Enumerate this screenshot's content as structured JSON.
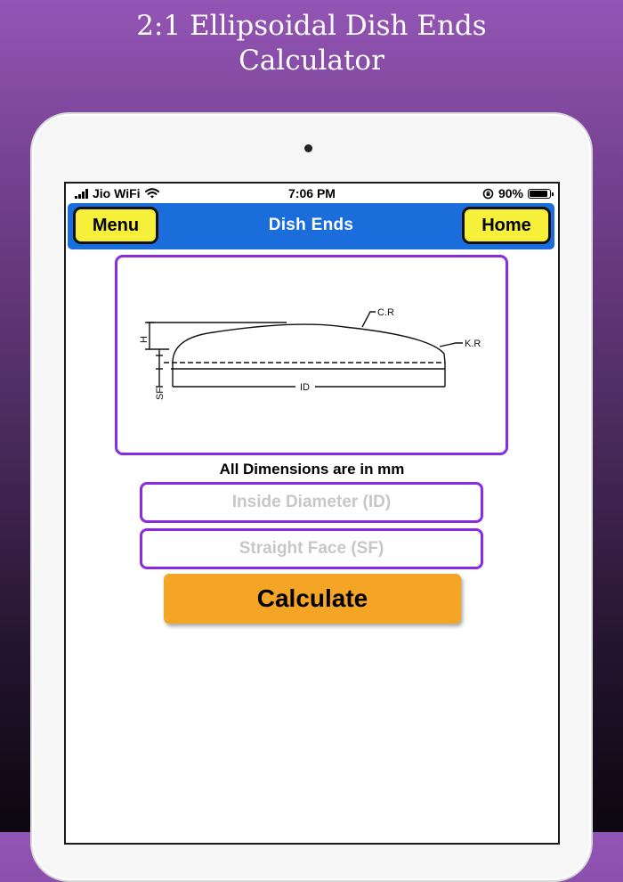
{
  "promo": {
    "title_line1": "2:1 Ellipsoidal Dish Ends",
    "title_line2": "Calculator"
  },
  "status_bar": {
    "carrier": "Jio WiFi",
    "time": "7:06 PM",
    "battery_percent": "90%",
    "battery_level": 0.9
  },
  "navbar": {
    "menu_label": "Menu",
    "title": "Dish Ends",
    "home_label": "Home"
  },
  "diagram": {
    "labels": {
      "crown_radius": "C.R",
      "knuckle_radius": "K.R",
      "inside_diameter": "ID",
      "height": "H",
      "straight_face": "SF"
    }
  },
  "form": {
    "units_note": "All Dimensions are in mm",
    "inside_diameter_placeholder": "Inside Diameter (ID)",
    "straight_face_placeholder": "Straight Face (SF)",
    "calculate_label": "Calculate"
  },
  "colors": {
    "navbar_blue": "#1c6ddc",
    "nav_button_yellow": "#f7f03a",
    "field_border_purple": "#8a2be2",
    "calculate_orange": "#f4a526"
  }
}
